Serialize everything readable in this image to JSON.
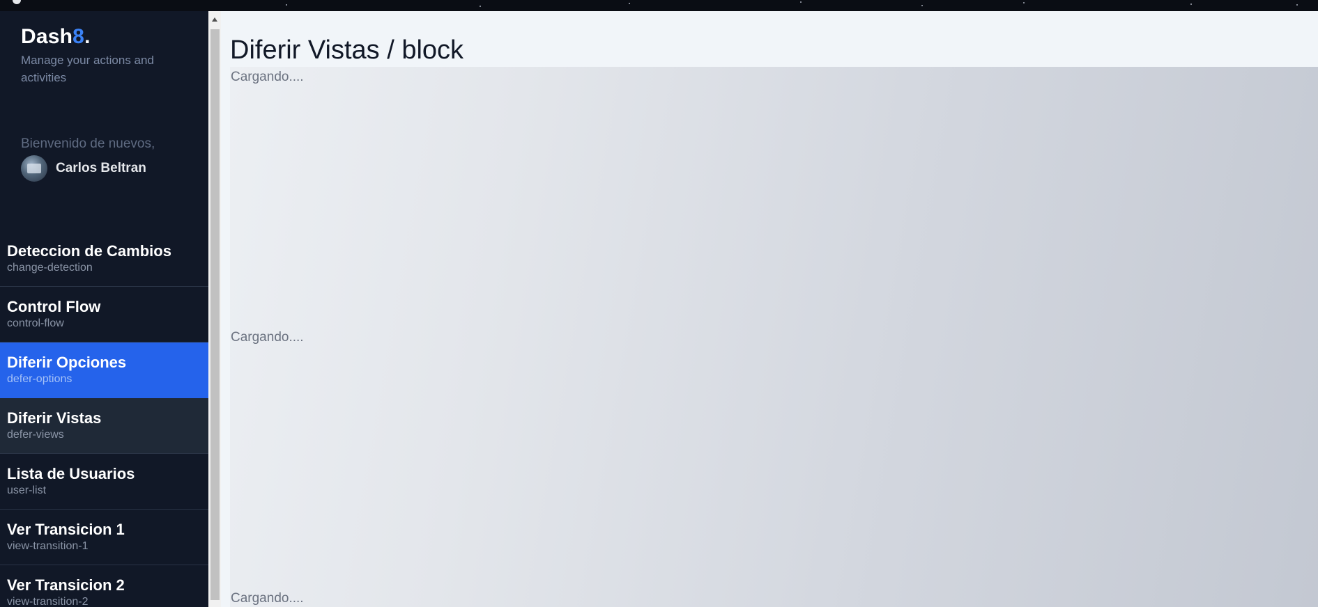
{
  "brand": {
    "name": "Dash",
    "accent": "8",
    "suffix": "."
  },
  "tagline": "Manage your actions and activities",
  "welcome": "Bienvenido de nuevos,",
  "user": {
    "name": "Carlos Beltran"
  },
  "nav": [
    {
      "title": "Deteccion de Cambios",
      "sub": "change-detection",
      "state": "normal"
    },
    {
      "title": "Control Flow",
      "sub": "control-flow",
      "state": "normal"
    },
    {
      "title": "Diferir Opciones",
      "sub": "defer-options",
      "state": "active"
    },
    {
      "title": "Diferir Vistas",
      "sub": "defer-views",
      "state": "hover"
    },
    {
      "title": "Lista de Usuarios",
      "sub": "user-list",
      "state": "normal"
    },
    {
      "title": "Ver Transicion 1",
      "sub": "view-transition-1",
      "state": "normal"
    },
    {
      "title": "Ver Transicion 2",
      "sub": "view-transition-2",
      "state": "normal"
    }
  ],
  "page_title": "Diferir Vistas / block",
  "loading": [
    "Cargando....",
    "Cargando....",
    "Cargando...."
  ],
  "colors": {
    "sidebar_bg": "#111827",
    "accent": "#3b82f6",
    "active_item": "#2563eb",
    "main_bg": "#f1f5f9"
  }
}
